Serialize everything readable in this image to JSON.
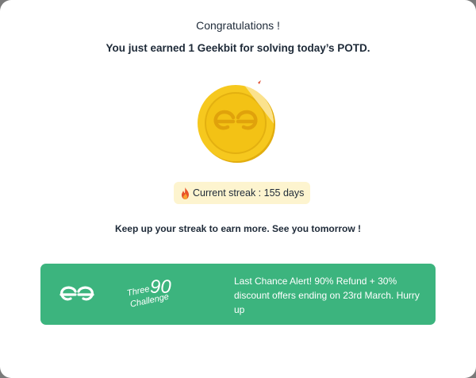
{
  "header": {
    "title": "Congratulations !",
    "subtitle": "You just earned 1 Geekbit for solving today’s POTD."
  },
  "coin": {
    "icon": "gfg-coin-icon",
    "color": "#f5c518"
  },
  "streak": {
    "icon": "flame-icon",
    "label": "Current streak : 155 days"
  },
  "message": "Keep up your streak to earn more. See you tomorrow !",
  "banner": {
    "color": "#3cb47e",
    "logo_icon": "gfg-logo-icon",
    "challenge_word1": "Three",
    "challenge_number": "90",
    "challenge_word2": "Challenge",
    "text": "Last Chance Alert! 90% Refund + 30% discount offers ending on 23rd March. Hurry up"
  }
}
